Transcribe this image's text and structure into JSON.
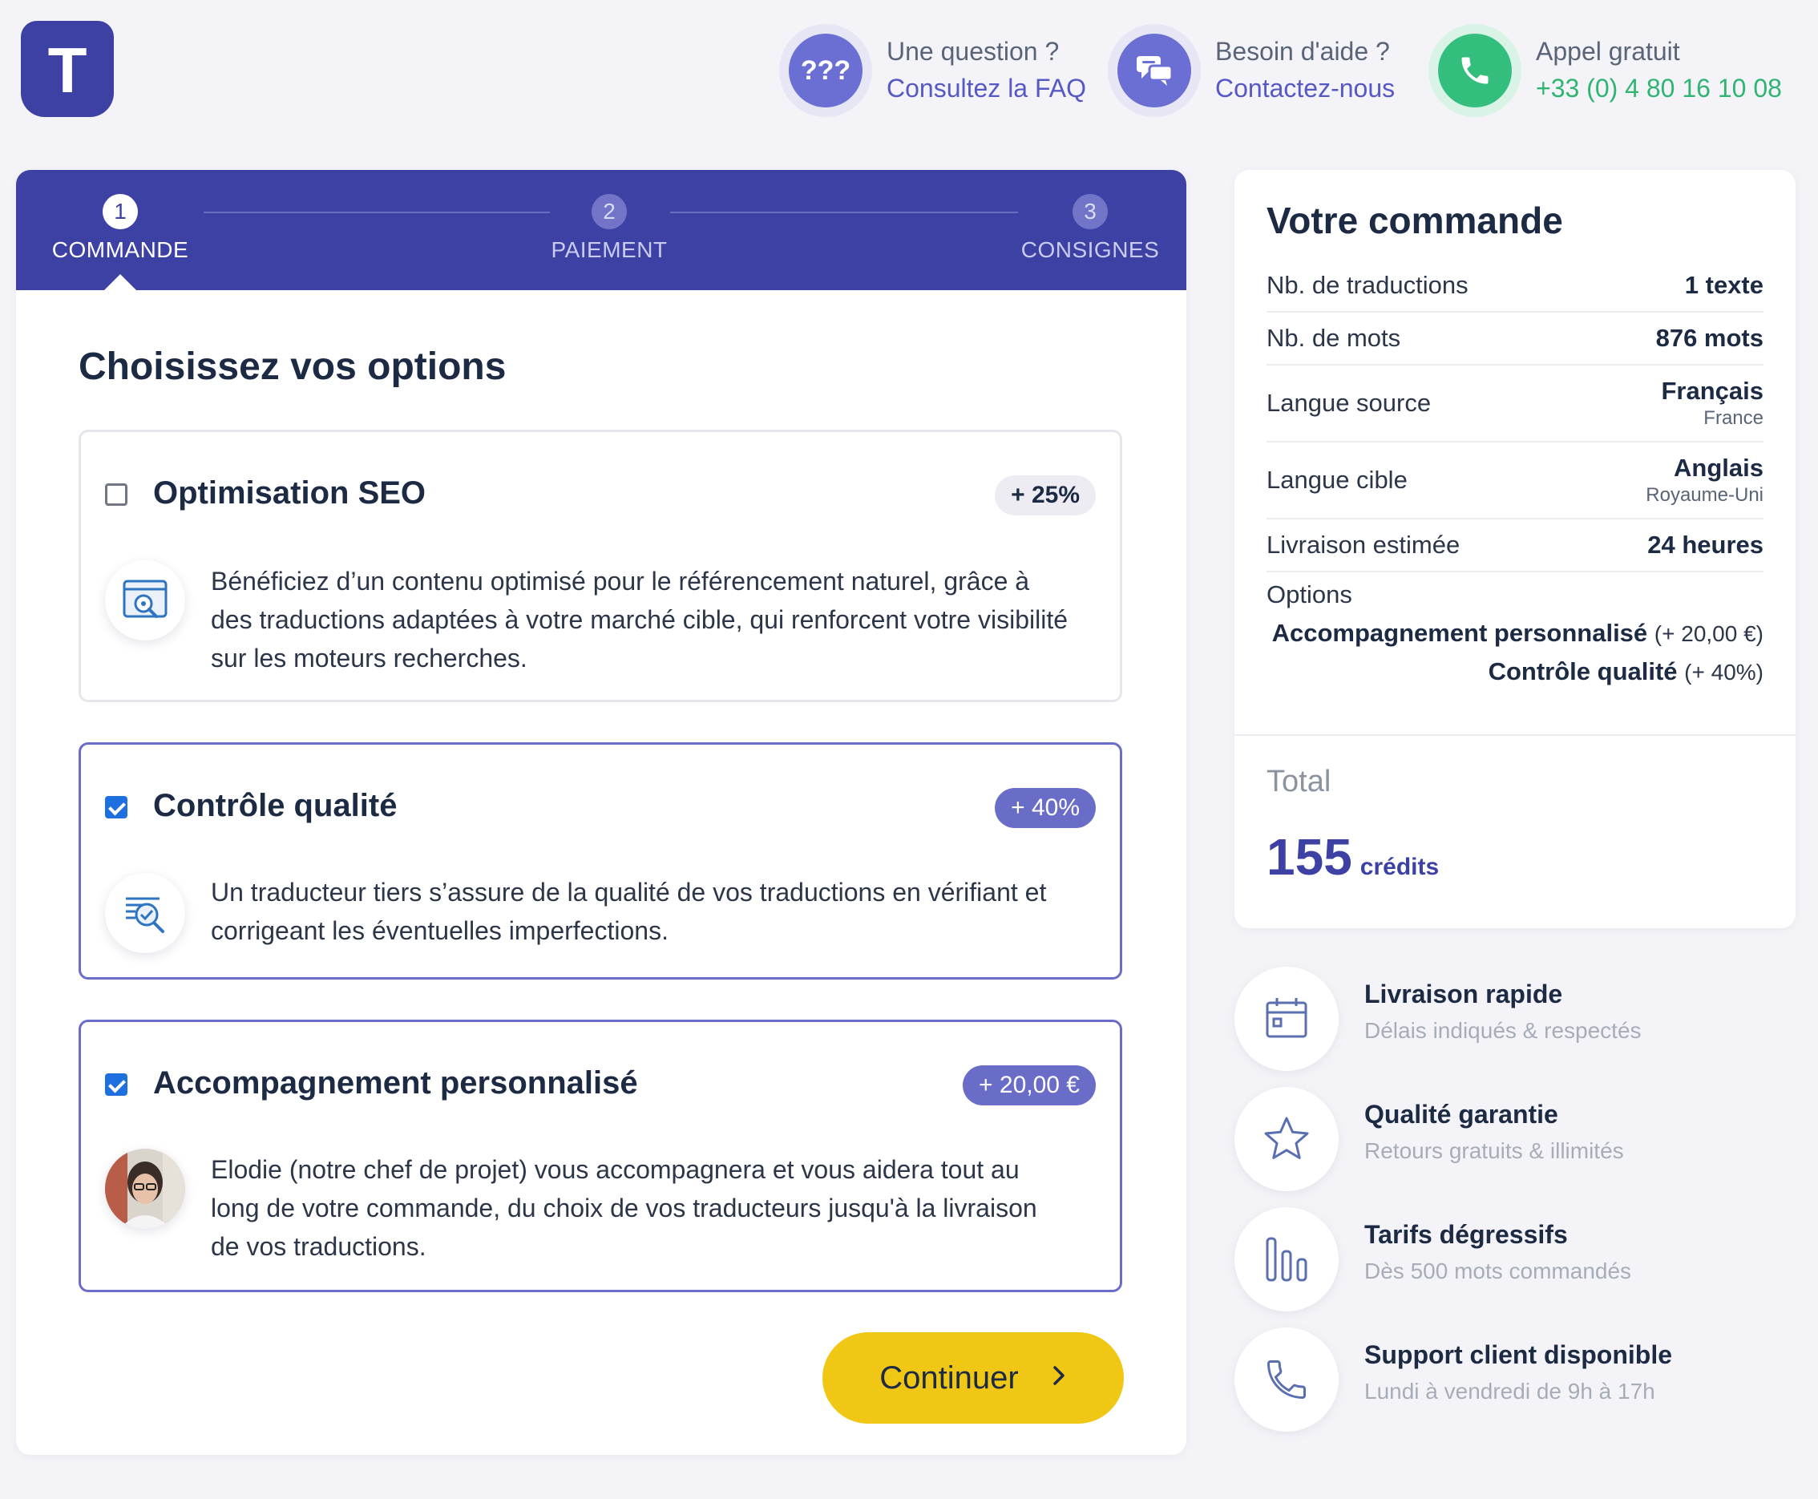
{
  "header": {
    "logo_letter": "T",
    "faq": {
      "icon": "question-marks-icon",
      "glyph": "???",
      "label": "Une question ?",
      "link": "Consultez la FAQ"
    },
    "help": {
      "icon": "chat-bubbles-icon",
      "label": "Besoin d'aide ?",
      "link": "Contactez-nous"
    },
    "call": {
      "icon": "phone-icon",
      "label": "Appel gratuit",
      "link": "+33 (0) 4 80 16 10 08"
    }
  },
  "stepper": {
    "steps": [
      {
        "num": "1",
        "label": "COMMANDE",
        "active": true
      },
      {
        "num": "2",
        "label": "PAIEMENT",
        "active": false
      },
      {
        "num": "3",
        "label": "CONSIGNES",
        "active": false
      }
    ]
  },
  "main": {
    "title": "Choisissez vos options",
    "options": [
      {
        "title": "Optimisation SEO",
        "badge": "+ 25%",
        "checked": false,
        "icon": "seo-search-icon",
        "description": "Bénéficiez d’un contenu optimisé pour le référencement naturel, grâce à des traductions adaptées à votre marché cible, qui renforcent votre visibilité sur les moteurs recherches."
      },
      {
        "title": "Contrôle qualité",
        "badge": "+ 40%",
        "checked": true,
        "icon": "quality-check-icon",
        "description": "Un traducteur tiers s’assure de la qualité de vos traductions en vérifiant et corrigeant les éventuelles imperfections."
      },
      {
        "title": "Accompagnement personnalisé",
        "badge": "+ 20,00 €",
        "checked": true,
        "icon": "project-manager-avatar",
        "description": "Elodie (notre chef de projet) vous accompagnera et vous aidera tout au long de votre commande, du choix de vos traducteurs jusqu'à la livraison de vos traductions."
      }
    ],
    "continue_label": "Continuer"
  },
  "summary": {
    "title": "Votre commande",
    "rows": [
      {
        "key": "Nb. de traductions",
        "value": "1 texte"
      },
      {
        "key": "Nb. de mots",
        "value": "876 mots"
      },
      {
        "key": "Langue source",
        "value": "Français",
        "sub": "France"
      },
      {
        "key": "Langue cible",
        "value": "Anglais",
        "sub": "Royaume-Uni"
      },
      {
        "key": "Livraison estimée",
        "value": "24 heures"
      }
    ],
    "options_label": "Options",
    "options": [
      {
        "name": "Accompagnement personnalisé",
        "price": "(+ 20,00 €)"
      },
      {
        "name": "Contrôle qualité",
        "price": "(+ 40%)"
      }
    ],
    "total_label": "Total",
    "total_value": "155",
    "total_unit": "crédits"
  },
  "features": [
    {
      "icon": "calendar-icon",
      "title": "Livraison rapide",
      "subtitle": "Délais indiqués & respectés"
    },
    {
      "icon": "star-icon",
      "title": "Qualité garantie",
      "subtitle": "Retours gratuits & illimités"
    },
    {
      "icon": "bar-chart-icon",
      "title": "Tarifs dégressifs",
      "subtitle": "Dès 500 mots commandés"
    },
    {
      "icon": "phone-icon",
      "title": "Support client disponible",
      "subtitle": "Lundi à vendredi de 9h à 17h"
    }
  ],
  "colors": {
    "brand": "#3d41a4",
    "accent": "#6a6dc8",
    "green": "#34be7e",
    "cta": "#f0c714"
  }
}
